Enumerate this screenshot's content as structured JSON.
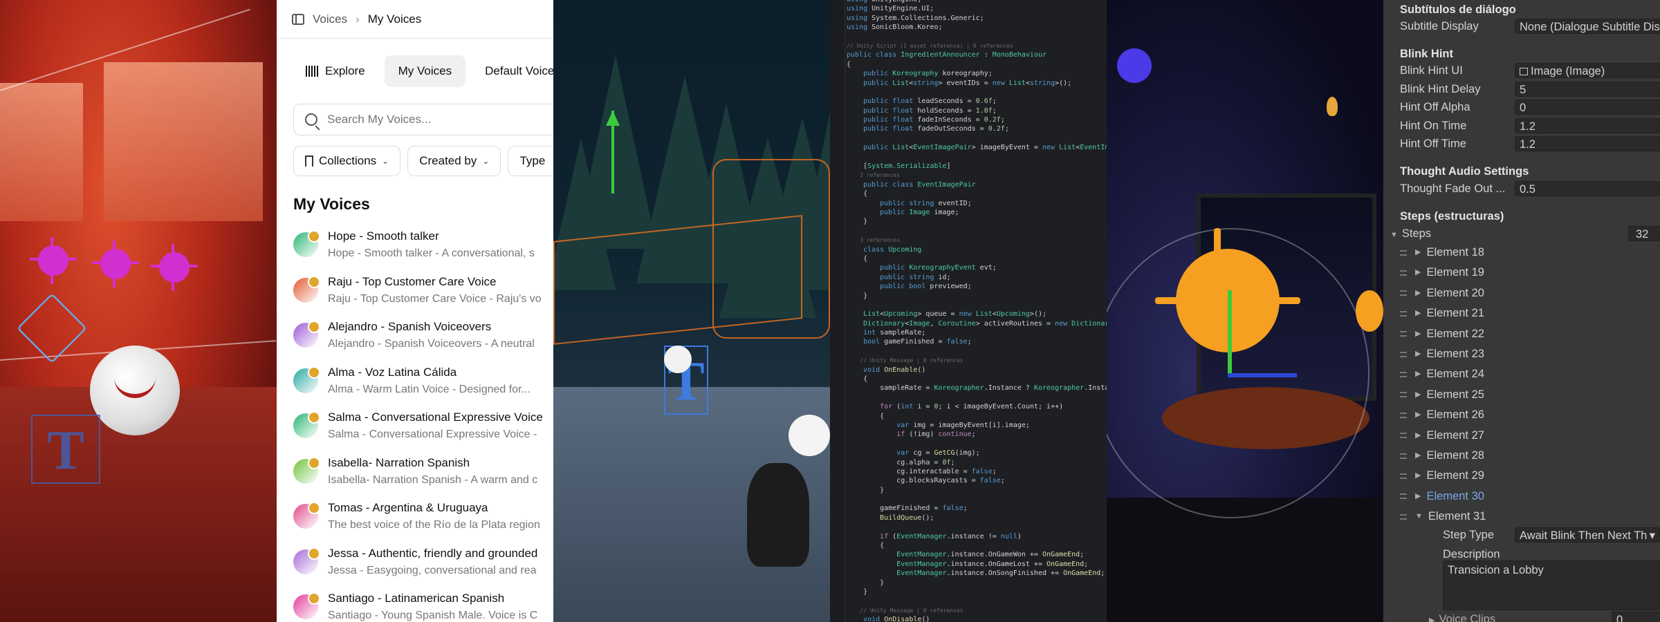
{
  "voices": {
    "breadcrumb": [
      "Voices",
      "My Voices"
    ],
    "tabs": [
      {
        "label": "Explore",
        "icon": "waveform-icon"
      },
      {
        "label": "My Voices"
      },
      {
        "label": "Default Voices"
      }
    ],
    "search_placeholder": "Search My Voices...",
    "filters": [
      "Collections",
      "Created by",
      "Type"
    ],
    "section_title": "My Voices",
    "items": [
      {
        "title": "Hope - Smooth talker",
        "subtitle": "Hope - Smooth talker - A conversational, s",
        "color": "#2bb673"
      },
      {
        "title": "Raju - Top Customer Care Voice",
        "subtitle": "Raju - Top Customer Care Voice - Raju's vo",
        "color": "#e2572e"
      },
      {
        "title": "Alejandro - Spanish Voiceovers",
        "subtitle": "Alejandro - Spanish Voiceovers - A neutral",
        "color": "#9a5ad6"
      },
      {
        "title": "Alma - Voz Latina Cálida",
        "subtitle": "Alma - Warm Latin Voice - Designed for...",
        "color": "#29a8a0"
      },
      {
        "title": "Salma - Conversational Expressive Voice",
        "subtitle": "Salma - Conversational Expressive Voice -",
        "color": "#2bb673"
      },
      {
        "title": "Isabella- Narration Spanish",
        "subtitle": "Isabella- Narration Spanish - A warm and c",
        "color": "#6fc23a"
      },
      {
        "title": "Tomas - Argentina & Uruguaya",
        "subtitle": "The best voice of the Río de la Plata region",
        "color": "#e04b8a"
      },
      {
        "title": "Jessa - Authentic, friendly and grounded",
        "subtitle": "Jessa - Easygoing, conversational and rea",
        "color": "#a46ad8"
      },
      {
        "title": "Santiago - Latinamerican Spanish",
        "subtitle": "Santiago - Young Spanish Male. Voice is C",
        "color": "#e03a9a"
      }
    ]
  },
  "code": {
    "lines": [
      [
        "k:using",
        "v: UnityEngine;"
      ],
      [
        "k:using",
        "v: UnityEngine.UI;"
      ],
      [
        "k:using",
        "v: System.Collections.Generic;"
      ],
      [
        "k:using",
        "v: SonicBloom.Koreo;"
      ],
      [],
      [
        "c:// Unity Script (1 asset reference) | 0 references"
      ],
      [
        "k:public class ",
        "t:IngredientAnnouncer",
        "v: : ",
        "t:MonoBehaviour"
      ],
      [
        "v:{"
      ],
      [
        "v:    ",
        "k:public ",
        "t:Koreography",
        "v: koreography;"
      ],
      [
        "v:    ",
        "k:public ",
        "t:List",
        "v:<",
        "k:string",
        "v:> eventIDs = ",
        "k:new ",
        "t:List",
        "v:<",
        "k:string",
        "v:>();"
      ],
      [],
      [
        "v:    ",
        "k:public float ",
        "v:leadSeconds = ",
        "n:0.6f",
        "v:;"
      ],
      [
        "v:    ",
        "k:public float ",
        "v:holdSeconds = ",
        "n:1.0f",
        "v:;"
      ],
      [
        "v:    ",
        "k:public float ",
        "v:fadeInSeconds = ",
        "n:0.2f",
        "v:;"
      ],
      [
        "v:    ",
        "k:public float ",
        "v:fadeOutSeconds = ",
        "n:0.2f",
        "v:;"
      ],
      [],
      [
        "v:    ",
        "k:public ",
        "t:List",
        "v:<",
        "t:EventImagePair",
        "v:> imageByEvent = ",
        "k:new ",
        "t:List",
        "v:<",
        "t:EventIm"
      ],
      [],
      [
        "v:    [",
        "t:System.Serializable",
        "v:]"
      ],
      [
        "c:    2 references"
      ],
      [
        "v:    ",
        "k:public class ",
        "t:EventImagePair"
      ],
      [
        "v:    {"
      ],
      [
        "v:        ",
        "k:public string ",
        "v:eventID;"
      ],
      [
        "v:        ",
        "k:public ",
        "t:Image",
        "v: image;"
      ],
      [
        "v:    }"
      ],
      [],
      [
        "c:    3 references"
      ],
      [
        "v:    ",
        "k:class ",
        "t:Upcoming"
      ],
      [
        "v:    {"
      ],
      [
        "v:        ",
        "k:public ",
        "t:KoreographyEvent",
        "v: evt;"
      ],
      [
        "v:        ",
        "k:public string ",
        "v:id;"
      ],
      [
        "v:        ",
        "k:public bool ",
        "v:previewed;"
      ],
      [
        "v:    }"
      ],
      [],
      [
        "v:    ",
        "t:List",
        "v:<",
        "t:Upcoming",
        "v:> queue = ",
        "k:new ",
        "t:List",
        "v:<",
        "t:Upcoming",
        "v:>();"
      ],
      [
        "v:    ",
        "t:Dictionary",
        "v:<",
        "t:Image",
        "v:, ",
        "t:Coroutine",
        "v:> activeRoutines = ",
        "k:new ",
        "t:Dictionar"
      ],
      [
        "v:    ",
        "k:int ",
        "v:sampleRate;"
      ],
      [
        "v:    ",
        "k:bool ",
        "v:gameFinished = ",
        "k:false",
        "v:;"
      ],
      [],
      [
        "c:    // Unity Message | 0 references"
      ],
      [
        "v:    ",
        "k:void ",
        "f:OnEnable",
        "v:()"
      ],
      [
        "v:    {"
      ],
      [
        "v:        sampleRate = ",
        "t:Koreographer",
        "v:.Instance ? ",
        "t:Koreographer",
        "v:.Insta"
      ],
      [],
      [
        "v:        ",
        "p:for ",
        "v:(",
        "k:int ",
        "v:i = ",
        "n:0",
        "v:; i < imageByEvent.Count; i++)"
      ],
      [
        "v:        {"
      ],
      [
        "v:            ",
        "k:var ",
        "v:img = imageByEvent[i].image;"
      ],
      [
        "v:            ",
        "p:if ",
        "v:(!img) ",
        "p:continue",
        "v:;"
      ],
      [],
      [
        "v:            ",
        "k:var ",
        "v:cg = ",
        "f:GetCG",
        "v:(img);"
      ],
      [
        "v:            cg.alpha = ",
        "n:0f",
        "v:;"
      ],
      [
        "v:            cg.interactable = ",
        "k:false",
        "v:;"
      ],
      [
        "v:            cg.blocksRaycasts = ",
        "k:false",
        "v:;"
      ],
      [
        "v:        }"
      ],
      [],
      [
        "v:        gameFinished = ",
        "k:false",
        "v:;"
      ],
      [
        "v:        ",
        "f:BuildQueue",
        "v:();"
      ],
      [],
      [
        "v:        ",
        "p:if ",
        "v:(",
        "t:EventManager",
        "v:.instance != ",
        "k:null",
        "v:)"
      ],
      [
        "v:        {"
      ],
      [
        "v:            ",
        "t:EventManager",
        "v:.instance.OnGameWon += ",
        "f:OnGameEnd",
        "v:;"
      ],
      [
        "v:            ",
        "t:EventManager",
        "v:.instance.OnGameLost += ",
        "f:OnGameEnd",
        "v:;"
      ],
      [
        "v:            ",
        "t:EventManager",
        "v:.instance.OnSongFinished += ",
        "f:OnGameEnd",
        "v:;"
      ],
      [
        "v:        }"
      ],
      [
        "v:    }"
      ],
      [],
      [
        "c:    // Unity Message | 0 references"
      ],
      [
        "v:    ",
        "k:void ",
        "f:OnDisable",
        "v:()"
      ]
    ]
  },
  "inspector": {
    "subtitles_header": "Subtítulos de diálogo",
    "subtitle_display_label": "Subtitle Display",
    "subtitle_display_value": "None (Dialogue Subtitle Dis",
    "blink_header": "Blink Hint",
    "blink_ui_label": "Blink Hint UI",
    "blink_ui_value": "Image (Image)",
    "blink_delay_label": "Blink Hint Delay",
    "blink_delay_value": "5",
    "hint_off_alpha_label": "Hint Off Alpha",
    "hint_off_alpha_value": "0",
    "hint_on_time_label": "Hint On Time",
    "hint_on_time_value": "1.2",
    "hint_off_time_label": "Hint Off Time",
    "hint_off_time_value": "1.2",
    "thought_header": "Thought Audio Settings",
    "thought_fade_label": "Thought Fade Out ...",
    "thought_fade_value": "0.5",
    "steps_header": "Steps (estructuras)",
    "steps_label": "Steps",
    "steps_count": "32",
    "elements": [
      "Element 18",
      "Element 19",
      "Element 20",
      "Element 21",
      "Element 22",
      "Element 23",
      "Element 24",
      "Element 25",
      "Element 26",
      "Element 27",
      "Element 28",
      "Element 29",
      "Element 30",
      "Element 31"
    ],
    "selected_element": "Element 30",
    "step_type_label": "Step Type",
    "step_type_value": "Await Blink Then Next Th",
    "description_label": "Description",
    "description_value": "Transicion a Lobby",
    "voice_clips_label": "Voice Clips",
    "voice_clips_value": "0"
  }
}
